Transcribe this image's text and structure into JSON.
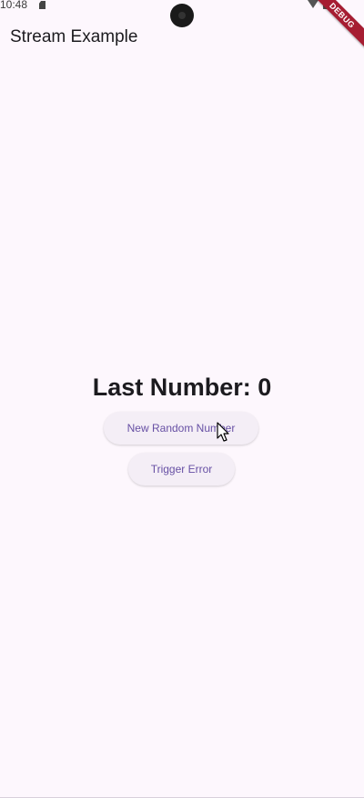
{
  "status_bar": {
    "time": "10:48"
  },
  "debug_banner": {
    "label": "DEBUG"
  },
  "app_bar": {
    "title": "Stream Example"
  },
  "content": {
    "last_number_text": "Last Number: 0",
    "random_button_label": "New Random Number",
    "error_button_label": "Trigger Error"
  },
  "colors": {
    "background": "#fdf7fd",
    "button_text": "#6750a4",
    "button_bg": "#f4eef6",
    "debug_banner": "#a61d32"
  }
}
